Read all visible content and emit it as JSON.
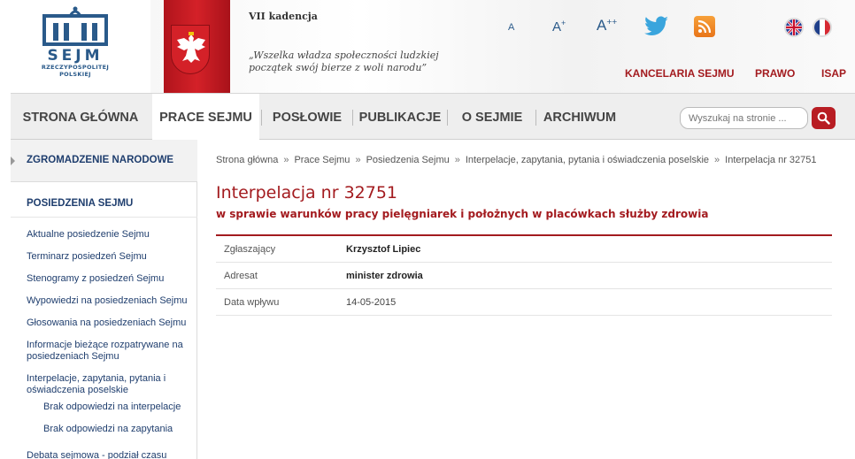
{
  "header": {
    "logo_name": "SEJM",
    "logo_sub_line1": "RZECZYPOSPOLITEJ",
    "logo_sub_line2": "POLSKIEJ",
    "kadencja": "VII kadencja",
    "motto_line1": "„Wszelka władza społeczności ludzkiej",
    "motto_line2": "początek swój bierze z woli narodu”",
    "font_sizes": [
      {
        "label": "A",
        "sup": ""
      },
      {
        "label": "A",
        "sup": "+"
      },
      {
        "label": "A",
        "sup": "++"
      }
    ],
    "social_icons": [
      "twitter-icon",
      "rss-icon"
    ],
    "languages": [
      "lang-en-flag-icon",
      "lang-fr-flag-icon"
    ],
    "links": [
      "KANCELARIA SEJMU",
      "PRAWO",
      "ISAP"
    ]
  },
  "nav": {
    "items": [
      "STRONA GŁÓWNA",
      "PRACE SEJMU",
      "POSŁOWIE",
      "PUBLIKACJE",
      "O SEJMIE",
      "ARCHIWUM"
    ],
    "active_index": 1,
    "search_placeholder": "Wyszukaj na stronie ..."
  },
  "sidebar": {
    "top_item": "ZGROMADZENIE NARODOWE",
    "section": "POSIEDZENIA SEJMU",
    "links": [
      "Aktualne posiedzenie Sejmu",
      "Terminarz posiedzeń Sejmu",
      "Stenogramy z posiedzeń Sejmu",
      "Wypowiedzi na posiedzeniach Sejmu",
      "Głosowania na posiedzeniach Sejmu",
      "Informacje bieżące rozpatrywane na posiedzeniach Sejmu",
      "Interpelacje, zapytania, pytania i oświadczenia poselskie"
    ],
    "sub_links": [
      "Brak odpowiedzi na interpelacje",
      "Brak odpowiedzi na zapytania"
    ],
    "last_link": "Debata sejmowa - podział czasu"
  },
  "breadcrumb": [
    "Strona główna",
    "Prace Sejmu",
    "Posiedzenia Sejmu",
    "Interpelacje, zapytania, pytania i oświadczenia poselskie",
    "Interpelacja nr 32751"
  ],
  "breadcrumb_sep": "»",
  "content": {
    "title": "Interpelacja nr 32751",
    "subtitle": "w sprawie warunków pracy pielęgniarek i położnych w placówkach służby zdrowia",
    "fields": [
      {
        "label": "Zgłaszający",
        "value": "Krzysztof Lipiec"
      },
      {
        "label": "Adresat",
        "value": "minister zdrowia"
      },
      {
        "label": "Data wpływu",
        "value": "14-05-2015"
      }
    ]
  },
  "colors": {
    "accent_red": "#a31b1f",
    "link_blue": "#1f3e6e",
    "logo_blue": "#2a5a8a",
    "nav_bg": "#eeeeee"
  }
}
